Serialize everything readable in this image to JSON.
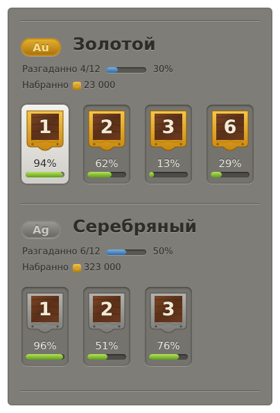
{
  "sections": [
    {
      "badge": "Au",
      "title": "Золотой",
      "solved_label": "Разгаданно",
      "solved": "4/12",
      "solved_fraction": 0.3,
      "solved_percent": "30%",
      "score_label": "Набранно",
      "score": "23 000",
      "levels": [
        {
          "number": "1",
          "percent": "94%",
          "progress": 0.94,
          "selected": true
        },
        {
          "number": "2",
          "percent": "62%",
          "progress": 0.62,
          "selected": false
        },
        {
          "number": "3",
          "percent": "13%",
          "progress": 0.13,
          "selected": false
        },
        {
          "number": "6",
          "percent": "29%",
          "progress": 0.29,
          "selected": false
        }
      ]
    },
    {
      "badge": "Ag",
      "title": "Серебряный",
      "solved_label": "Разгаданно",
      "solved": "6/12",
      "solved_fraction": 0.5,
      "solved_percent": "50%",
      "score_label": "Набранно",
      "score": "323 000",
      "levels": [
        {
          "number": "1",
          "percent": "96%",
          "progress": 0.96,
          "selected": false
        },
        {
          "number": "2",
          "percent": "51%",
          "progress": 0.51,
          "selected": false
        },
        {
          "number": "3",
          "percent": "76%",
          "progress": 0.76,
          "selected": false
        }
      ]
    }
  ],
  "colors": {
    "panel": "#7f7d77",
    "gold_frame": "#e0a21f",
    "silver_frame": "#8e8d88",
    "wood": "#5e3419",
    "progress_green": "#8cc63f",
    "solved_blue": "#3f80c4"
  }
}
